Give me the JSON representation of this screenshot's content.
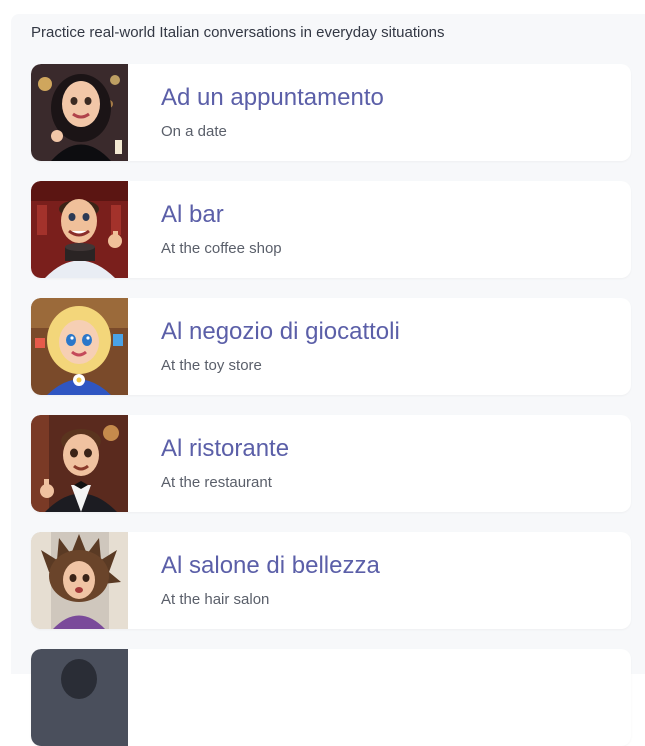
{
  "header": {
    "subtitle": "Practice real-world Italian conversations in everyday situations"
  },
  "scenarios": [
    {
      "title": "Ad un appuntamento",
      "subtitle": "On a date",
      "image": "woman-on-date-avatar"
    },
    {
      "title": "Al bar",
      "subtitle": "At the coffee shop",
      "image": "barista-avatar"
    },
    {
      "title": "Al negozio di giocattoli",
      "subtitle": "At the toy store",
      "image": "child-toy-store-avatar"
    },
    {
      "title": "Al ristorante",
      "subtitle": "At the restaurant",
      "image": "waiter-avatar"
    },
    {
      "title": "Al salone di bellezza",
      "subtitle": "At the hair salon",
      "image": "messy-hair-avatar"
    }
  ],
  "colors": {
    "title": "#5b5fa8",
    "subtitle": "#5a5f6a",
    "background": "#f7f8fa"
  }
}
